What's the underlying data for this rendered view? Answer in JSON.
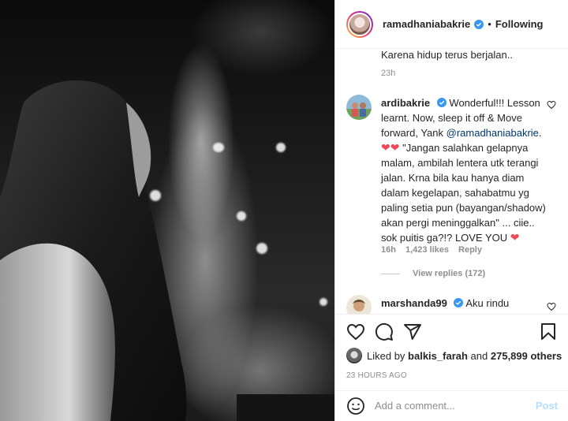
{
  "header": {
    "username": "ramadhaniabakrie",
    "separator": "•",
    "follow_state": "Following"
  },
  "caption": {
    "tail_text": "Karena hidup terus berjalan..",
    "time": "23h"
  },
  "comments": [
    {
      "username": "ardibakrie",
      "text_part1": "Wonderful!!! Lesson learnt. Now, sleep it off & Move forward, Yank ",
      "mention": "@ramadhaniabakrie",
      "text_part2": ". ",
      "emoji_pair": "❤❤",
      "text_part3": " \"Jangan salahkan gelapnya malam, ambilah lentera utk terangi jalan. Krna bila kau hanya diam dalam kegelapan, sahabatmu yg paling setia pun (bayangan/shadow) akan pergi meninggalkan\" ... ciie.. sok puitis ga?!? LOVE YOU ",
      "emoji_end": "❤",
      "time": "16h",
      "likes": "1,423 likes",
      "reply_label": "Reply",
      "view_replies": "View replies (172)"
    },
    {
      "username": "marshanda99",
      "text": "Aku rindu"
    }
  ],
  "actions": {
    "liked_by_prefix": "Liked by",
    "liked_by_user": "balkis_farah",
    "liked_by_suffix": "and",
    "liked_by_count": "275,899 others",
    "posted_ago": "23 HOURS AGO"
  },
  "comment_box": {
    "placeholder": "Add a comment...",
    "post_label": "Post"
  },
  "colors": {
    "verified": "#3897f0",
    "heart": "#ed4956",
    "post_disabled": "#b2dffc"
  }
}
